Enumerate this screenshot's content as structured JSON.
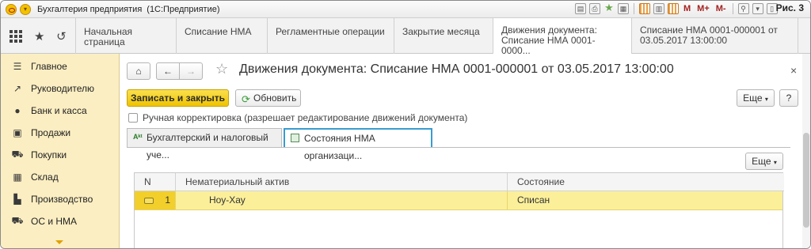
{
  "window": {
    "title": "Бухгалтерия предприятия",
    "subtitle": "(1С:Предприятие)",
    "figure_label": "Рис. 3",
    "toolbar_m": [
      "M",
      "M+",
      "M-"
    ]
  },
  "tabs": [
    {
      "label": "Начальная страница"
    },
    {
      "label": "Списание НМА"
    },
    {
      "label": "Регламентные операции"
    },
    {
      "label": "Закрытие месяца"
    },
    {
      "label_line1": "Движения документа:",
      "label_line2": "Списание НМА 0001-0000..."
    },
    {
      "label_line1": "Списание НМА 0001-000001 от",
      "label_line2": "03.05.2017 13:00:00"
    }
  ],
  "sidebar": {
    "items": [
      {
        "label": "Главное",
        "icon": "menu-icon"
      },
      {
        "label": "Руководителю",
        "icon": "trend-icon"
      },
      {
        "label": "Банк и касса",
        "icon": "coin-icon"
      },
      {
        "label": "Продажи",
        "icon": "bag-icon"
      },
      {
        "label": "Покупки",
        "icon": "cart-icon"
      },
      {
        "label": "Склад",
        "icon": "warehouse-icon"
      },
      {
        "label": "Производство",
        "icon": "factory-icon"
      },
      {
        "label": "ОС и НМА",
        "icon": "truck-icon"
      }
    ]
  },
  "main": {
    "title": "Движения документа: Списание НМА 0001-000001 от 03.05.2017 13:00:00",
    "write_close_label": "Записать и закрыть",
    "refresh_label": "Обновить",
    "more_label": "Еще",
    "help_label": "?",
    "manual_correction_label": "Ручная корректировка (разрешает редактирование движений документа)",
    "subtabs": [
      {
        "label": "Бухгалтерский и налоговый уче..."
      },
      {
        "label": "Состояния НМА организаци..."
      }
    ],
    "table": {
      "columns": [
        "N",
        "Нематериальный актив",
        "Состояние"
      ],
      "rows": [
        {
          "n": "1",
          "asset": "Ноу-Хау",
          "state": "Списан"
        }
      ]
    }
  },
  "colors": {
    "accent_yellow": "#f2c200",
    "sidebar_bg": "#fbeec2",
    "active_subtab_border": "#3a9bd0",
    "selected_row": "#fbef9a"
  }
}
